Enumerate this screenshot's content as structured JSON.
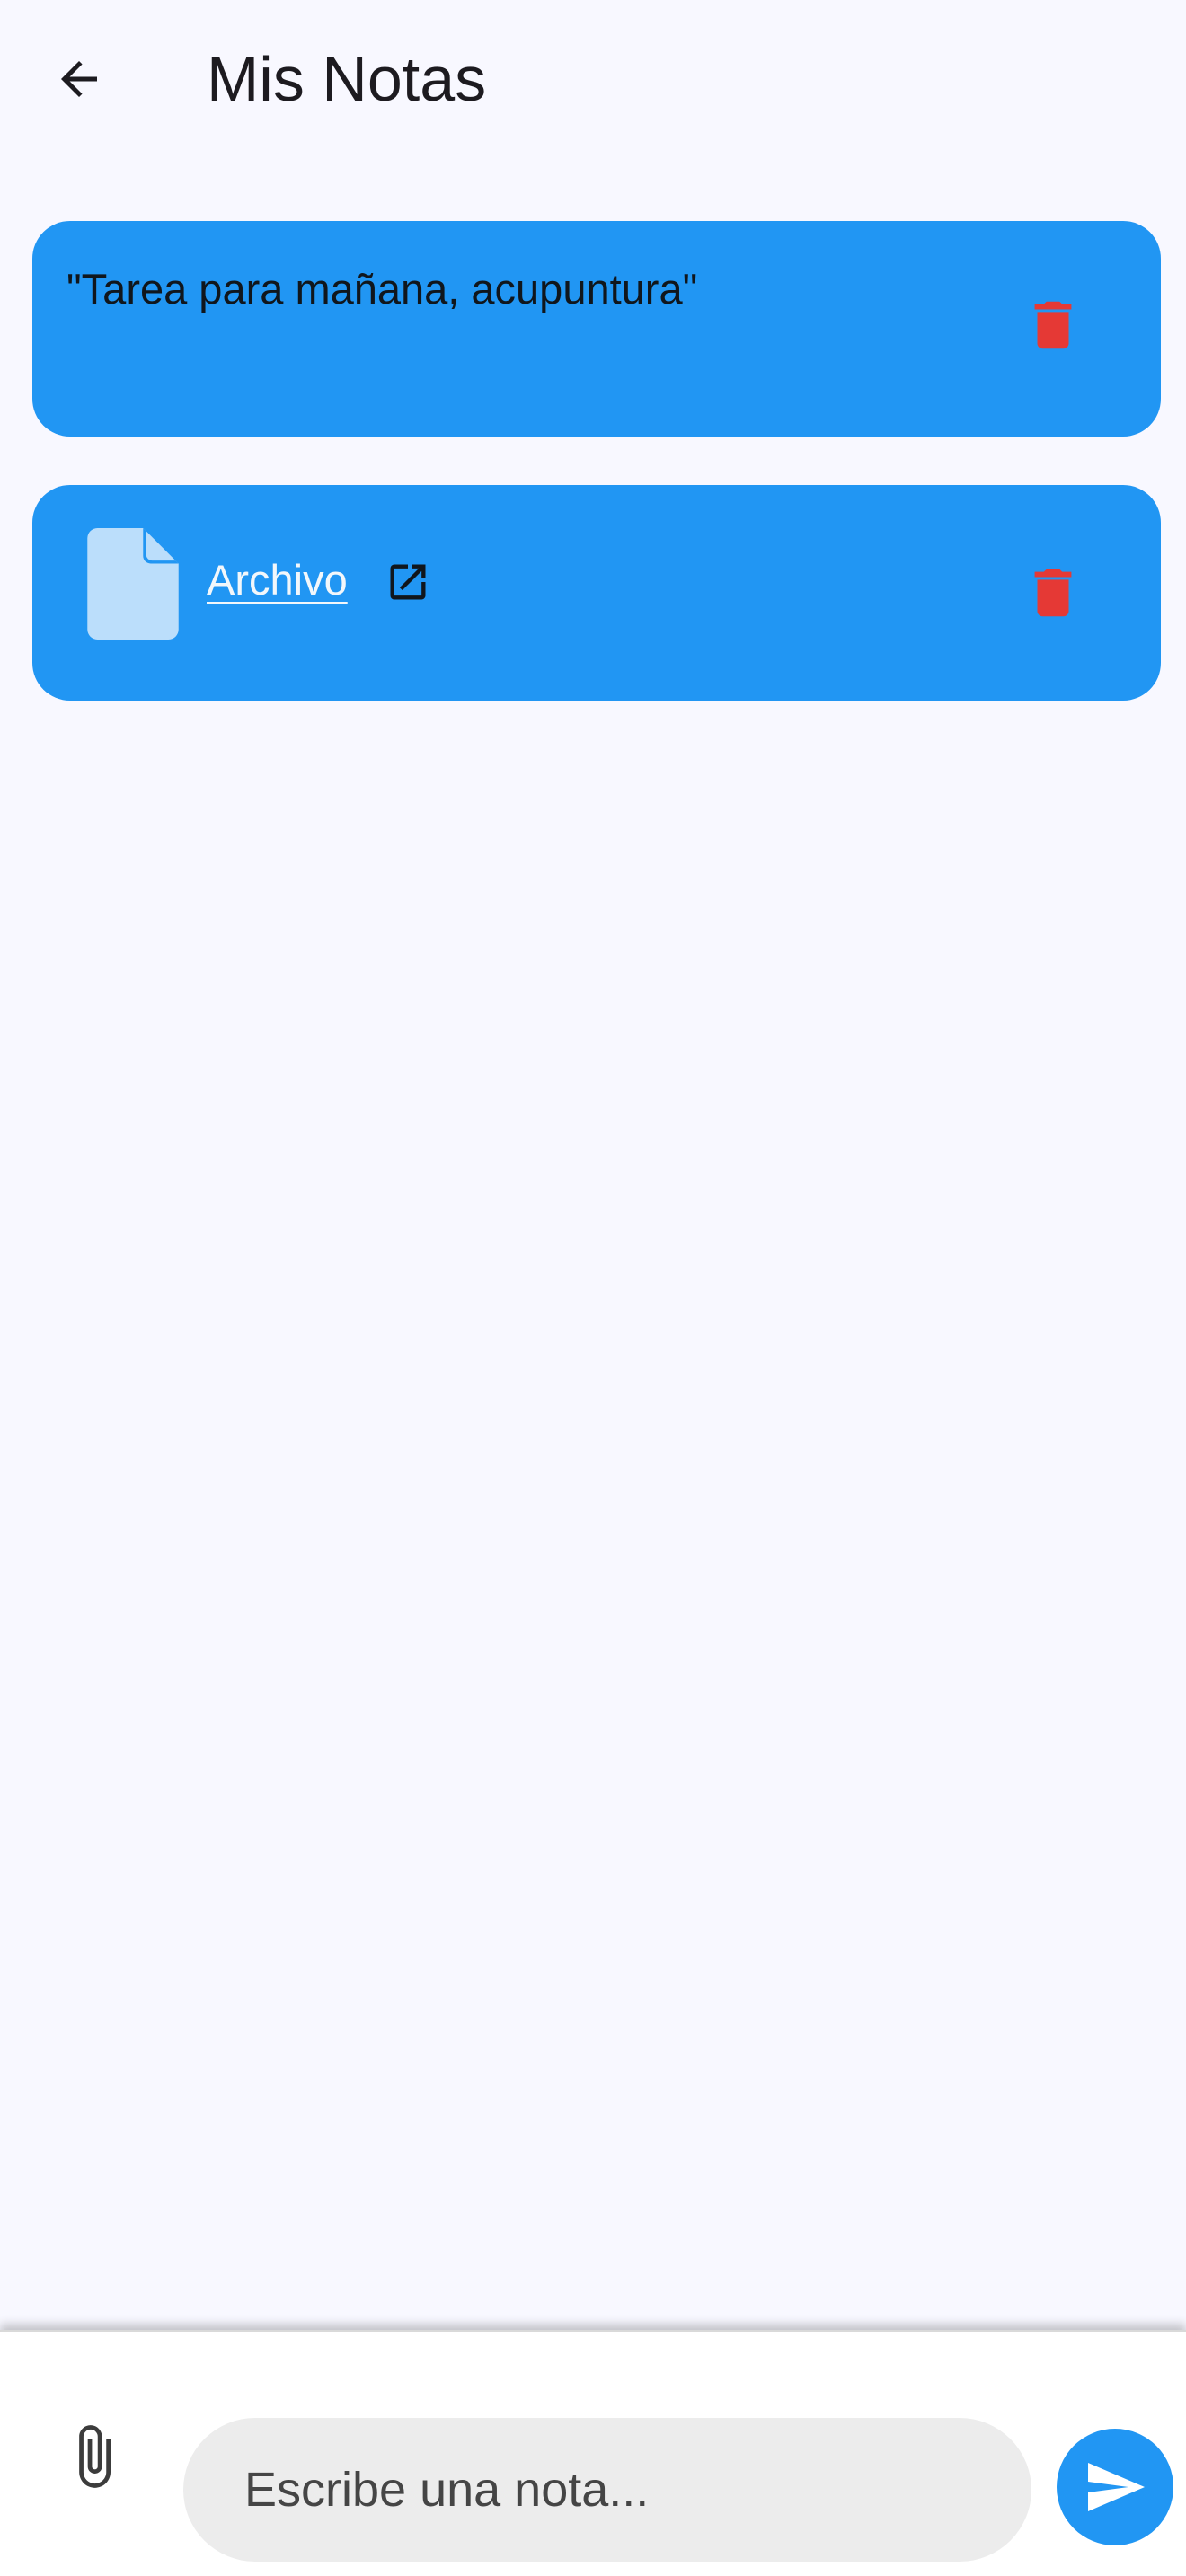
{
  "appbar": {
    "title": "Mis Notas",
    "back_icon": "arrow-back-icon"
  },
  "notes": [
    {
      "type": "text",
      "text": "\"Tarea para mañana, acupuntura\"",
      "delete_icon": "trash-icon"
    },
    {
      "type": "file",
      "link_label": "Archivo",
      "file_icon": "file-icon",
      "open_icon": "open-in-new-icon",
      "delete_icon": "trash-icon"
    }
  ],
  "composer": {
    "placeholder": "Escribe una nota...",
    "value": "",
    "attach_icon": "paperclip-icon",
    "send_icon": "send-icon"
  },
  "colors": {
    "background": "#f8f8ff",
    "card": "#2196f3",
    "delete": "#e53935",
    "file_icon": "#bbdefb",
    "input_bg": "#ececec",
    "send_button": "#2196f3"
  }
}
